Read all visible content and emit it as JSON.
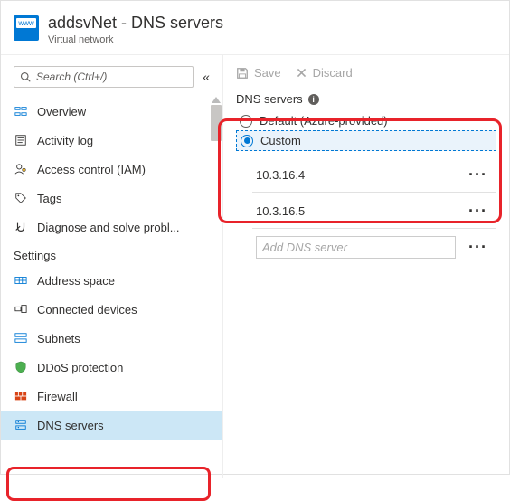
{
  "header": {
    "title": "addsvNet - DNS servers",
    "subtitle": "Virtual network"
  },
  "sidebar": {
    "search_placeholder": "Search (Ctrl+/)",
    "group_settings_label": "Settings",
    "items_top": [
      {
        "label": "Overview"
      },
      {
        "label": "Activity log"
      },
      {
        "label": "Access control (IAM)"
      },
      {
        "label": "Tags"
      },
      {
        "label": "Diagnose and solve probl..."
      }
    ],
    "items_settings": [
      {
        "label": "Address space"
      },
      {
        "label": "Connected devices"
      },
      {
        "label": "Subnets"
      },
      {
        "label": "DDoS protection"
      },
      {
        "label": "Firewall"
      },
      {
        "label": "DNS servers"
      }
    ]
  },
  "toolbar": {
    "save_label": "Save",
    "discard_label": "Discard"
  },
  "main": {
    "section_label": "DNS servers",
    "option_default": "Default (Azure-provided)",
    "option_custom": "Custom",
    "dns_entries": [
      "10.3.16.4",
      "10.3.16.5"
    ],
    "add_placeholder": "Add DNS server"
  }
}
